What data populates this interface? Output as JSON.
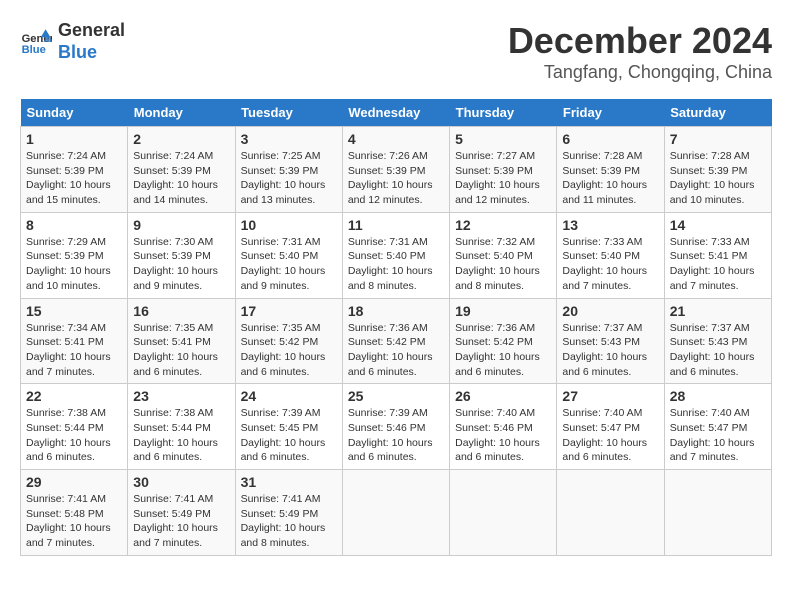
{
  "header": {
    "logo_line1": "General",
    "logo_line2": "Blue",
    "month": "December 2024",
    "location": "Tangfang, Chongqing, China"
  },
  "days_of_week": [
    "Sunday",
    "Monday",
    "Tuesday",
    "Wednesday",
    "Thursday",
    "Friday",
    "Saturday"
  ],
  "weeks": [
    [
      {
        "day": "1",
        "detail": "Sunrise: 7:24 AM\nSunset: 5:39 PM\nDaylight: 10 hours and 15 minutes."
      },
      {
        "day": "2",
        "detail": "Sunrise: 7:24 AM\nSunset: 5:39 PM\nDaylight: 10 hours and 14 minutes."
      },
      {
        "day": "3",
        "detail": "Sunrise: 7:25 AM\nSunset: 5:39 PM\nDaylight: 10 hours and 13 minutes."
      },
      {
        "day": "4",
        "detail": "Sunrise: 7:26 AM\nSunset: 5:39 PM\nDaylight: 10 hours and 12 minutes."
      },
      {
        "day": "5",
        "detail": "Sunrise: 7:27 AM\nSunset: 5:39 PM\nDaylight: 10 hours and 12 minutes."
      },
      {
        "day": "6",
        "detail": "Sunrise: 7:28 AM\nSunset: 5:39 PM\nDaylight: 10 hours and 11 minutes."
      },
      {
        "day": "7",
        "detail": "Sunrise: 7:28 AM\nSunset: 5:39 PM\nDaylight: 10 hours and 10 minutes."
      }
    ],
    [
      {
        "day": "8",
        "detail": "Sunrise: 7:29 AM\nSunset: 5:39 PM\nDaylight: 10 hours and 10 minutes."
      },
      {
        "day": "9",
        "detail": "Sunrise: 7:30 AM\nSunset: 5:39 PM\nDaylight: 10 hours and 9 minutes."
      },
      {
        "day": "10",
        "detail": "Sunrise: 7:31 AM\nSunset: 5:40 PM\nDaylight: 10 hours and 9 minutes."
      },
      {
        "day": "11",
        "detail": "Sunrise: 7:31 AM\nSunset: 5:40 PM\nDaylight: 10 hours and 8 minutes."
      },
      {
        "day": "12",
        "detail": "Sunrise: 7:32 AM\nSunset: 5:40 PM\nDaylight: 10 hours and 8 minutes."
      },
      {
        "day": "13",
        "detail": "Sunrise: 7:33 AM\nSunset: 5:40 PM\nDaylight: 10 hours and 7 minutes."
      },
      {
        "day": "14",
        "detail": "Sunrise: 7:33 AM\nSunset: 5:41 PM\nDaylight: 10 hours and 7 minutes."
      }
    ],
    [
      {
        "day": "15",
        "detail": "Sunrise: 7:34 AM\nSunset: 5:41 PM\nDaylight: 10 hours and 7 minutes."
      },
      {
        "day": "16",
        "detail": "Sunrise: 7:35 AM\nSunset: 5:41 PM\nDaylight: 10 hours and 6 minutes."
      },
      {
        "day": "17",
        "detail": "Sunrise: 7:35 AM\nSunset: 5:42 PM\nDaylight: 10 hours and 6 minutes."
      },
      {
        "day": "18",
        "detail": "Sunrise: 7:36 AM\nSunset: 5:42 PM\nDaylight: 10 hours and 6 minutes."
      },
      {
        "day": "19",
        "detail": "Sunrise: 7:36 AM\nSunset: 5:42 PM\nDaylight: 10 hours and 6 minutes."
      },
      {
        "day": "20",
        "detail": "Sunrise: 7:37 AM\nSunset: 5:43 PM\nDaylight: 10 hours and 6 minutes."
      },
      {
        "day": "21",
        "detail": "Sunrise: 7:37 AM\nSunset: 5:43 PM\nDaylight: 10 hours and 6 minutes."
      }
    ],
    [
      {
        "day": "22",
        "detail": "Sunrise: 7:38 AM\nSunset: 5:44 PM\nDaylight: 10 hours and 6 minutes."
      },
      {
        "day": "23",
        "detail": "Sunrise: 7:38 AM\nSunset: 5:44 PM\nDaylight: 10 hours and 6 minutes."
      },
      {
        "day": "24",
        "detail": "Sunrise: 7:39 AM\nSunset: 5:45 PM\nDaylight: 10 hours and 6 minutes."
      },
      {
        "day": "25",
        "detail": "Sunrise: 7:39 AM\nSunset: 5:46 PM\nDaylight: 10 hours and 6 minutes."
      },
      {
        "day": "26",
        "detail": "Sunrise: 7:40 AM\nSunset: 5:46 PM\nDaylight: 10 hours and 6 minutes."
      },
      {
        "day": "27",
        "detail": "Sunrise: 7:40 AM\nSunset: 5:47 PM\nDaylight: 10 hours and 6 minutes."
      },
      {
        "day": "28",
        "detail": "Sunrise: 7:40 AM\nSunset: 5:47 PM\nDaylight: 10 hours and 7 minutes."
      }
    ],
    [
      {
        "day": "29",
        "detail": "Sunrise: 7:41 AM\nSunset: 5:48 PM\nDaylight: 10 hours and 7 minutes."
      },
      {
        "day": "30",
        "detail": "Sunrise: 7:41 AM\nSunset: 5:49 PM\nDaylight: 10 hours and 7 minutes."
      },
      {
        "day": "31",
        "detail": "Sunrise: 7:41 AM\nSunset: 5:49 PM\nDaylight: 10 hours and 8 minutes."
      },
      null,
      null,
      null,
      null
    ]
  ]
}
